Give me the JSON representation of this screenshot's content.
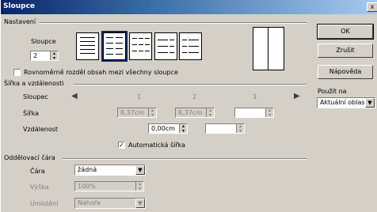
{
  "window": {
    "title": "Sloupce",
    "close_glyph": "x"
  },
  "settings": {
    "section_label": "Nastavení",
    "columns_label": "Sloupce",
    "columns_value": "2",
    "even_distribute_label": "Rovnoměrně rozděl obsah mezi všechny sloupce"
  },
  "width_spacing": {
    "section_label": "Šířka a vzdálenosti",
    "column_label": "Sloupec",
    "col_numbers": [
      "1",
      "2",
      "3"
    ],
    "width_label": "Šířka",
    "width_values": [
      "8,37cm",
      "8,37cm",
      ""
    ],
    "spacing_label": "Vzdálenost",
    "spacing_values": [
      "0,00cm",
      ""
    ],
    "auto_width_label": "Automatická šířka",
    "auto_width_checked": true
  },
  "separator": {
    "section_label": "Oddělovací čára",
    "line_label": "Čára",
    "line_value": "žádná",
    "height_label": "Výška",
    "height_value": "100%",
    "position_label": "Umístění",
    "position_value": "Nahoře"
  },
  "side": {
    "ok_label": "OK",
    "cancel_label": "Zrušit",
    "help_label": "Nápověda",
    "apply_label": "Použít na",
    "apply_value": "Aktuální oblast"
  }
}
